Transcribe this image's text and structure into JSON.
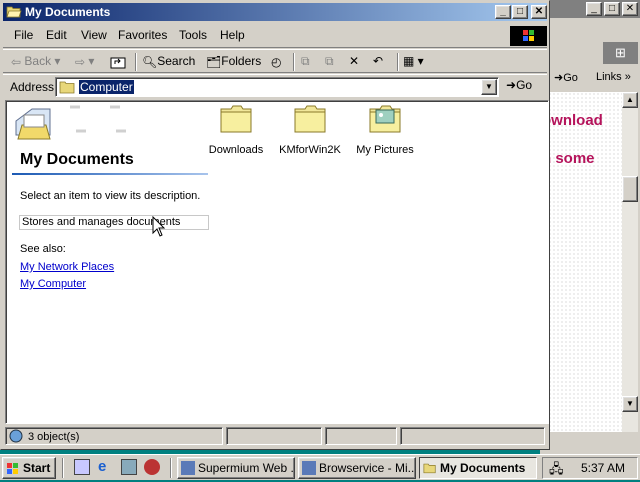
{
  "background_browser": {
    "toolbar": {
      "go_label": "Go",
      "links_label": "Links"
    },
    "content_lines": [
      "ownload",
      "n some"
    ],
    "accent_color": "#b5135b"
  },
  "window": {
    "title": "My Documents",
    "controls": {
      "minimize": "_",
      "maximize": "□",
      "close": "✕"
    }
  },
  "menu": [
    "File",
    "Edit",
    "View",
    "Favorites",
    "Tools",
    "Help"
  ],
  "toolbar": {
    "back_label": "Back",
    "search_label": "Search",
    "folders_label": "Folders"
  },
  "address": {
    "label": "Address",
    "value": "Computer",
    "go_label": "Go"
  },
  "panel": {
    "title": "My Documents",
    "description": "Select an item to view its description.",
    "hover_tip": "Stores and manages documents",
    "see_also": "See also:",
    "links": [
      "My Network Places",
      "My Computer"
    ]
  },
  "files": [
    {
      "label": "Downloads",
      "icon": "folder-icon"
    },
    {
      "label": "KMforWin2K",
      "icon": "folder-icon"
    },
    {
      "label": "My Pictures",
      "icon": "pictures-folder-icon"
    }
  ],
  "status": {
    "text": "3 object(s)"
  },
  "taskbar": {
    "start_label": "Start",
    "tasks": [
      {
        "label": "Supermium Web ...",
        "active": false
      },
      {
        "label": "Browservice - Mi...",
        "active": false
      },
      {
        "label": "My Documents",
        "active": true
      }
    ],
    "clock": "5:37 AM"
  },
  "colors": {
    "title_active_start": "#0a246a",
    "title_active_end": "#a6caf0",
    "face": "#d4d0c8",
    "desktop": "#008080",
    "link": "#0000cc"
  }
}
